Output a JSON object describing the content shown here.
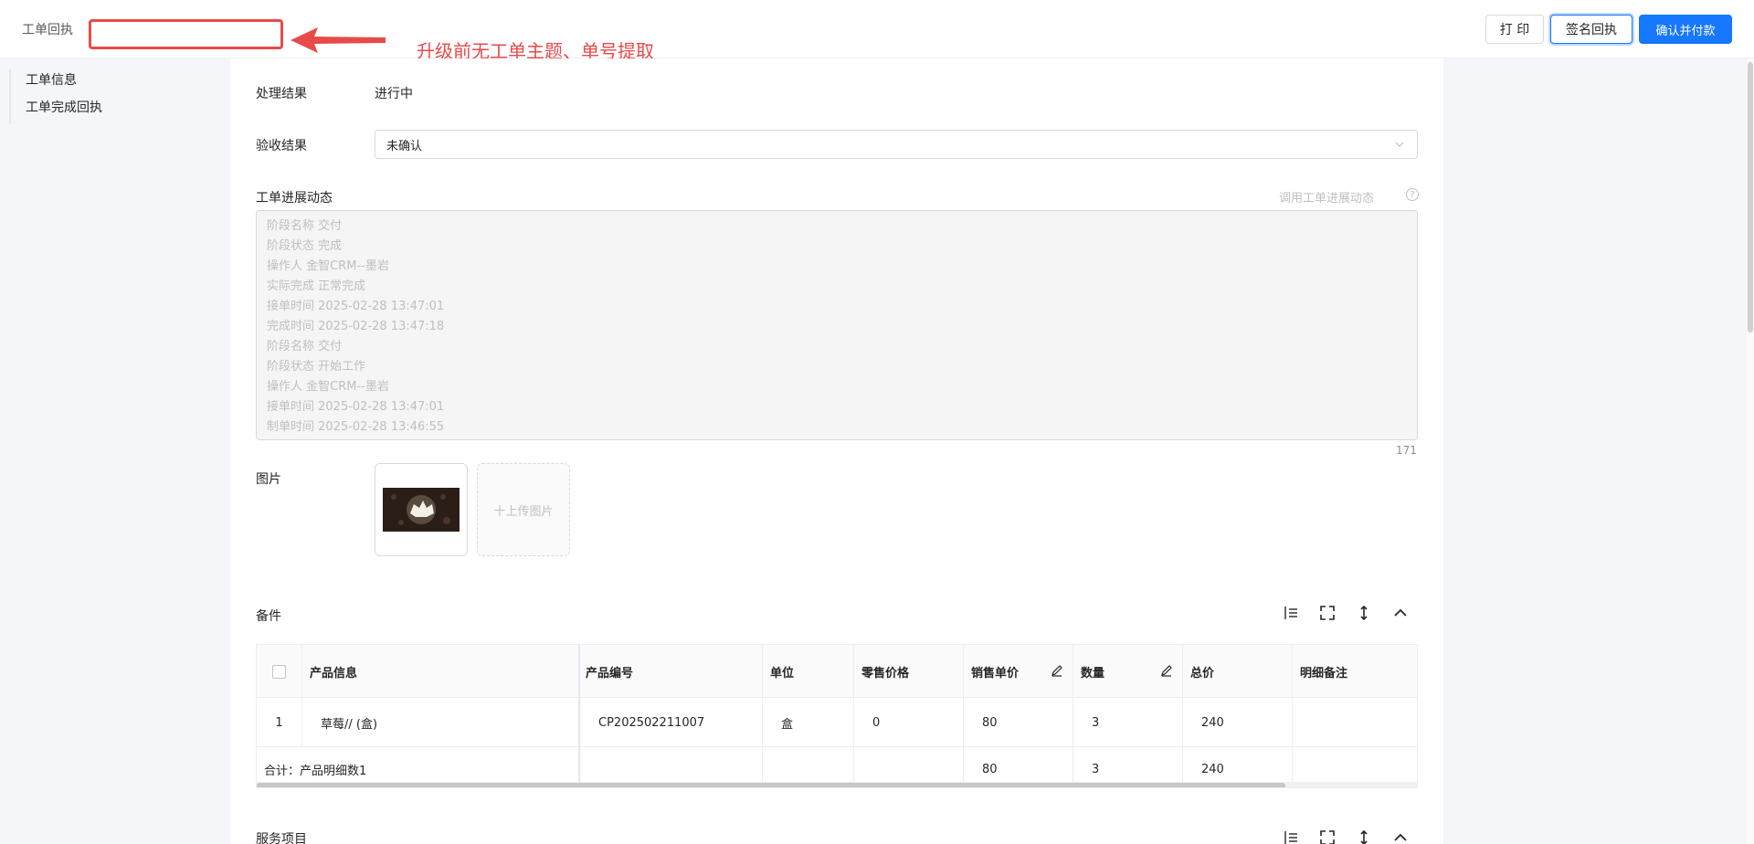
{
  "header": {
    "title": "工单回执",
    "annotation_text": "升级前无工单主题、单号提取",
    "buttons": {
      "print": "打 印",
      "sign": "签名回执",
      "confirm": "确认并付款"
    }
  },
  "sidebar": {
    "items": [
      {
        "label": "工单信息"
      },
      {
        "label": "工单完成回执"
      }
    ]
  },
  "form": {
    "result": {
      "label": "处理结果",
      "value": "进行中"
    },
    "acceptance": {
      "label": "验收结果",
      "value": "未确认"
    },
    "progress": {
      "label": "工单进展动态",
      "link": "调用工单进展动态",
      "lines": [
        "阶段名称 交付",
        "阶段状态 完成",
        "操作人 金智CRM--墨岩",
        "实际完成 正常完成",
        "接单时间 2025-02-28 13:47:01",
        "完成时间 2025-02-28 13:47:18",
        "阶段名称 交付",
        "阶段状态 开始工作",
        "操作人 金智CRM--墨岩",
        "接单时间 2025-02-28 13:47:01",
        "制单时间 2025-02-28 13:46:55"
      ],
      "char_count": "171"
    },
    "images": {
      "label": "图片",
      "upload_label": "十上传图片"
    }
  },
  "parts": {
    "title": "备件",
    "columns": [
      "产品信息",
      "产品编号",
      "单位",
      "零售价格",
      "销售单价",
      "数量",
      "总价",
      "明细备注"
    ],
    "rows": [
      {
        "index": "1",
        "product": "草莓// (盒)",
        "code": "CP202502211007",
        "unit": "盒",
        "retail": "0",
        "price": "80",
        "qty": "3",
        "total": "240",
        "remark": ""
      }
    ],
    "summary": {
      "label": "合计：产品明细数1",
      "price": "80",
      "qty": "3",
      "total": "240"
    }
  },
  "services": {
    "title": "服务项目"
  },
  "colors": {
    "primary": "#1677ff",
    "annotation": "#e84a4a"
  }
}
